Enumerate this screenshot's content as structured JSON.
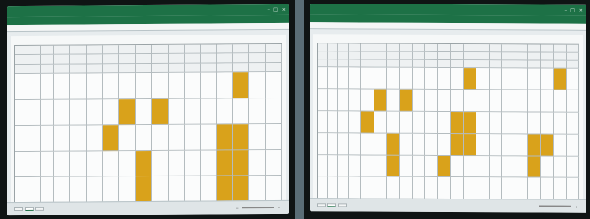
{
  "colors": {
    "excel_green": "#1d7146",
    "highlight": "#d9a21b",
    "backdrop": "#5a6d76"
  },
  "left_photo": {
    "titlebar": {
      "title": "",
      "window_controls": [
        "–",
        "□",
        "×"
      ]
    },
    "ribbon_tabs": [
      "",
      "",
      "",
      "",
      "",
      "",
      "",
      ""
    ],
    "sheet_tabs": [
      "",
      "",
      ""
    ],
    "grid": {
      "cols": 17,
      "rows": 8,
      "header_rows": 3,
      "highlights": [
        [
          3,
          14
        ],
        [
          4,
          7
        ],
        [
          4,
          9
        ],
        [
          5,
          6
        ],
        [
          5,
          13
        ],
        [
          5,
          14
        ],
        [
          6,
          8
        ],
        [
          6,
          13
        ],
        [
          6,
          14
        ],
        [
          7,
          8
        ],
        [
          7,
          13
        ],
        [
          7,
          14
        ]
      ]
    }
  },
  "right_photo": {
    "titlebar": {
      "title": "",
      "window_controls": [
        "–",
        "□",
        "×"
      ]
    },
    "ribbon_tabs": [
      "",
      "",
      "",
      "",
      "",
      "",
      "",
      ""
    ],
    "sheet_tabs": [
      "",
      "",
      ""
    ],
    "grid": {
      "cols": 21,
      "rows": 9,
      "header_rows": 3,
      "highlights": [
        [
          3,
          12
        ],
        [
          3,
          19
        ],
        [
          4,
          5
        ],
        [
          4,
          7
        ],
        [
          5,
          4
        ],
        [
          5,
          11
        ],
        [
          5,
          12
        ],
        [
          6,
          6
        ],
        [
          6,
          11
        ],
        [
          6,
          12
        ],
        [
          6,
          17
        ],
        [
          6,
          18
        ],
        [
          7,
          6
        ],
        [
          7,
          10
        ],
        [
          7,
          17
        ]
      ]
    }
  }
}
